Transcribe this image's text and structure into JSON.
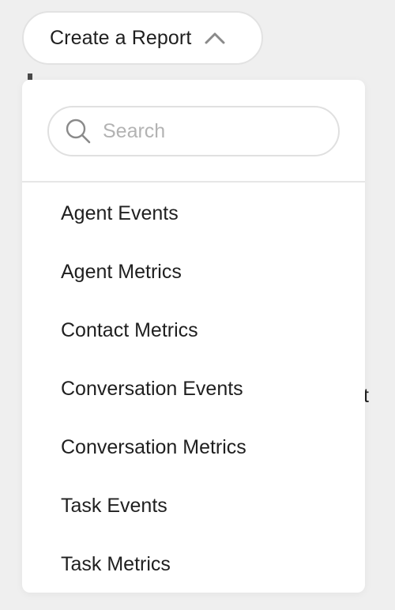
{
  "trigger": {
    "label": "Create a Report",
    "icon": "chevron-up-icon"
  },
  "background": {
    "partial_text": "t"
  },
  "search": {
    "placeholder": "Search",
    "value": "",
    "icon": "search-icon"
  },
  "menu": {
    "items": [
      {
        "label": "Agent Events"
      },
      {
        "label": "Agent Metrics"
      },
      {
        "label": "Contact Metrics"
      },
      {
        "label": "Conversation Events"
      },
      {
        "label": "Conversation Metrics"
      },
      {
        "label": "Task Events"
      },
      {
        "label": "Task Metrics"
      }
    ]
  },
  "colors": {
    "page_background": "#efefef",
    "surface": "#ffffff",
    "border": "#e2e2e2",
    "text": "#1f1f1f",
    "placeholder": "#b3b3b3",
    "icon": "#8a8a8a"
  }
}
